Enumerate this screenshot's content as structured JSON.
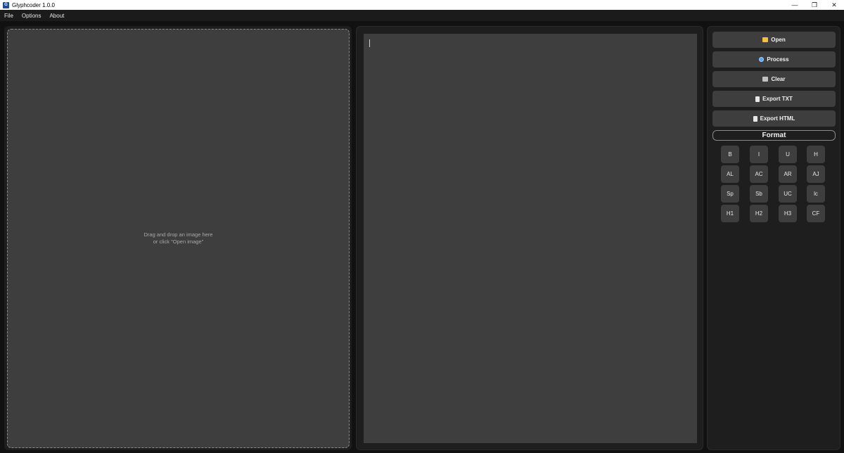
{
  "window": {
    "title": "Glyphcoder 1.0.0",
    "icon_letter": "G",
    "controls": {
      "minimize": "—",
      "restore": "❐",
      "close": "✕"
    }
  },
  "menu": {
    "items": [
      "File",
      "Options",
      "About"
    ]
  },
  "dropzone": {
    "line1": "Drag and drop an image here",
    "line2": "or click \"Open image\""
  },
  "actions": {
    "open": "Open",
    "process": "Process",
    "clear": "Clear",
    "export_txt": "Export TXT",
    "export_html": "Export HTML"
  },
  "format": {
    "title": "Format",
    "rows": [
      [
        "B",
        "I",
        "U",
        "H"
      ],
      [
        "AL",
        "AC",
        "AR",
        "AJ"
      ],
      [
        "Sp",
        "Sb",
        "UC",
        "lc"
      ],
      [
        "H1",
        "H2",
        "H3",
        "CF"
      ]
    ]
  }
}
